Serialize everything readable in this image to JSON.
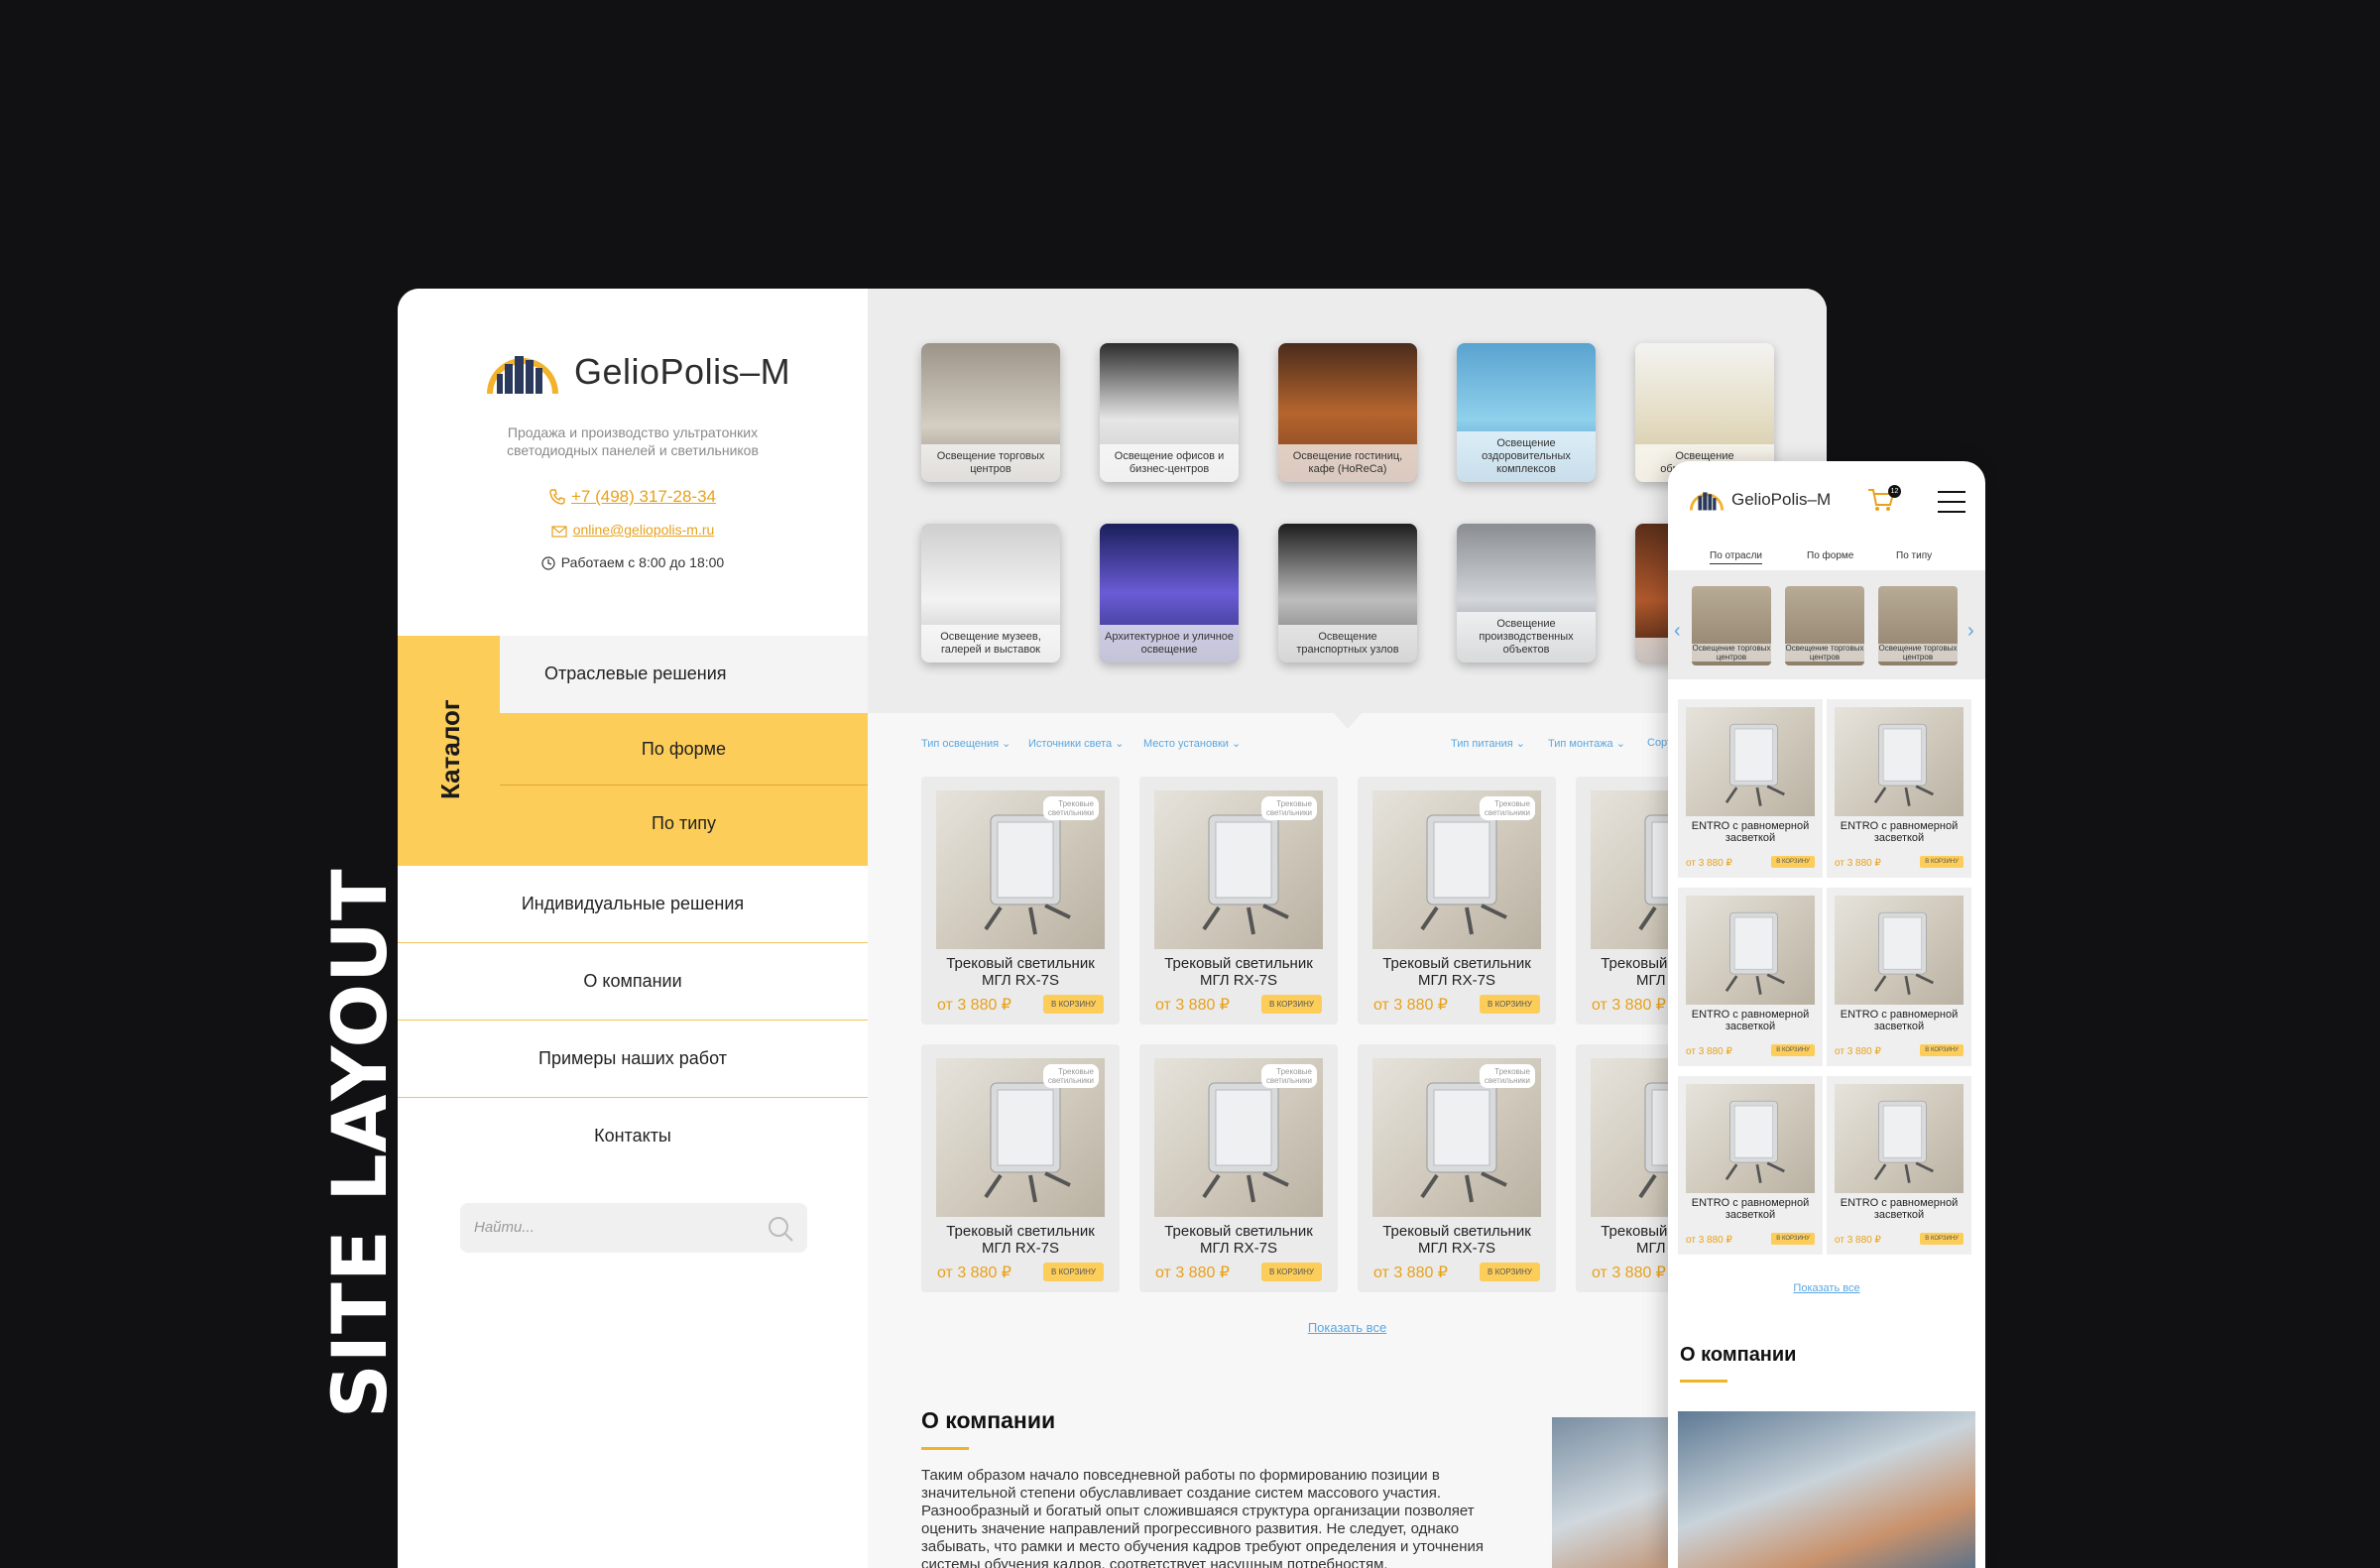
{
  "badge": "SITE LAYOUT",
  "brand": {
    "name": "GelioPolis–M",
    "tagline_1": "Продажа и производство ультратонких",
    "tagline_2": "светодиодных панелей и светильников"
  },
  "contacts": {
    "phone": "+7 (498) 317-28-34",
    "email": "online@geliopolis-m.ru",
    "hours": "Работаем с 8:00 до 18:00"
  },
  "catalog": {
    "label": "Каталог",
    "active": "Отраслевые решения",
    "sub_items": [
      "По форме",
      "По типу"
    ]
  },
  "menu": [
    "Индивидуальные решения",
    "О компании",
    "Примеры наших работ",
    "Контакты"
  ],
  "search": {
    "placeholder": "Найти..."
  },
  "tiles_row1": [
    "Освещение торговых центров",
    "Освещение офисов и бизнес-центров",
    "Освещение гостиниц, кафе (HoReCa)",
    "Освещение оздоровительных комплексов",
    "Освещение образовательных"
  ],
  "tiles_row2": [
    "Освещение музеев, галерей и выставок",
    "Архитектурное и уличное освещение",
    "Освещение транспортных узлов",
    "Освещение производственных объектов",
    "Осв"
  ],
  "filters_left": [
    "Тип освещения",
    "Источники света",
    "Место установки"
  ],
  "filters_right": [
    "Тип питания",
    "Тип монтажа",
    "Сорт"
  ],
  "product": {
    "tag_1": "Трековые",
    "tag_2": "светильники",
    "name_1": "Трековый светильник",
    "name_2": "МГЛ RX-7S",
    "price": "от 3 880 ₽",
    "button": "В КОРЗИНУ"
  },
  "show_all": "Показать все",
  "about": {
    "title": "О компании",
    "text": "Таким образом начало повседневной работы по формированию позиции в значительной степени обуславливает создание систем массового участия. Разнообразный и богатый опыт сложившаяся структура организации позволяет оценить значение направлений прогрессивного развития. Не следует, однако забывать, что рамки и место обучения кадров требуют определения и уточнения системы обучения кадров, соответствует насущным потребностям."
  },
  "mobile": {
    "cart_count": "12",
    "tabs": [
      "По отрасли",
      "По форме",
      "По типу"
    ],
    "tile_caption": "Освещение торговых центров",
    "product_name_1": "ENTRO с равномерной",
    "product_name_2": "засветкой",
    "product_price": "от 3 880 ₽",
    "product_button": "В КОРЗИНУ"
  },
  "colors": {
    "accent": "#fdcd5a",
    "accent_text": "#e8a11b",
    "link": "#5aa7e0"
  }
}
